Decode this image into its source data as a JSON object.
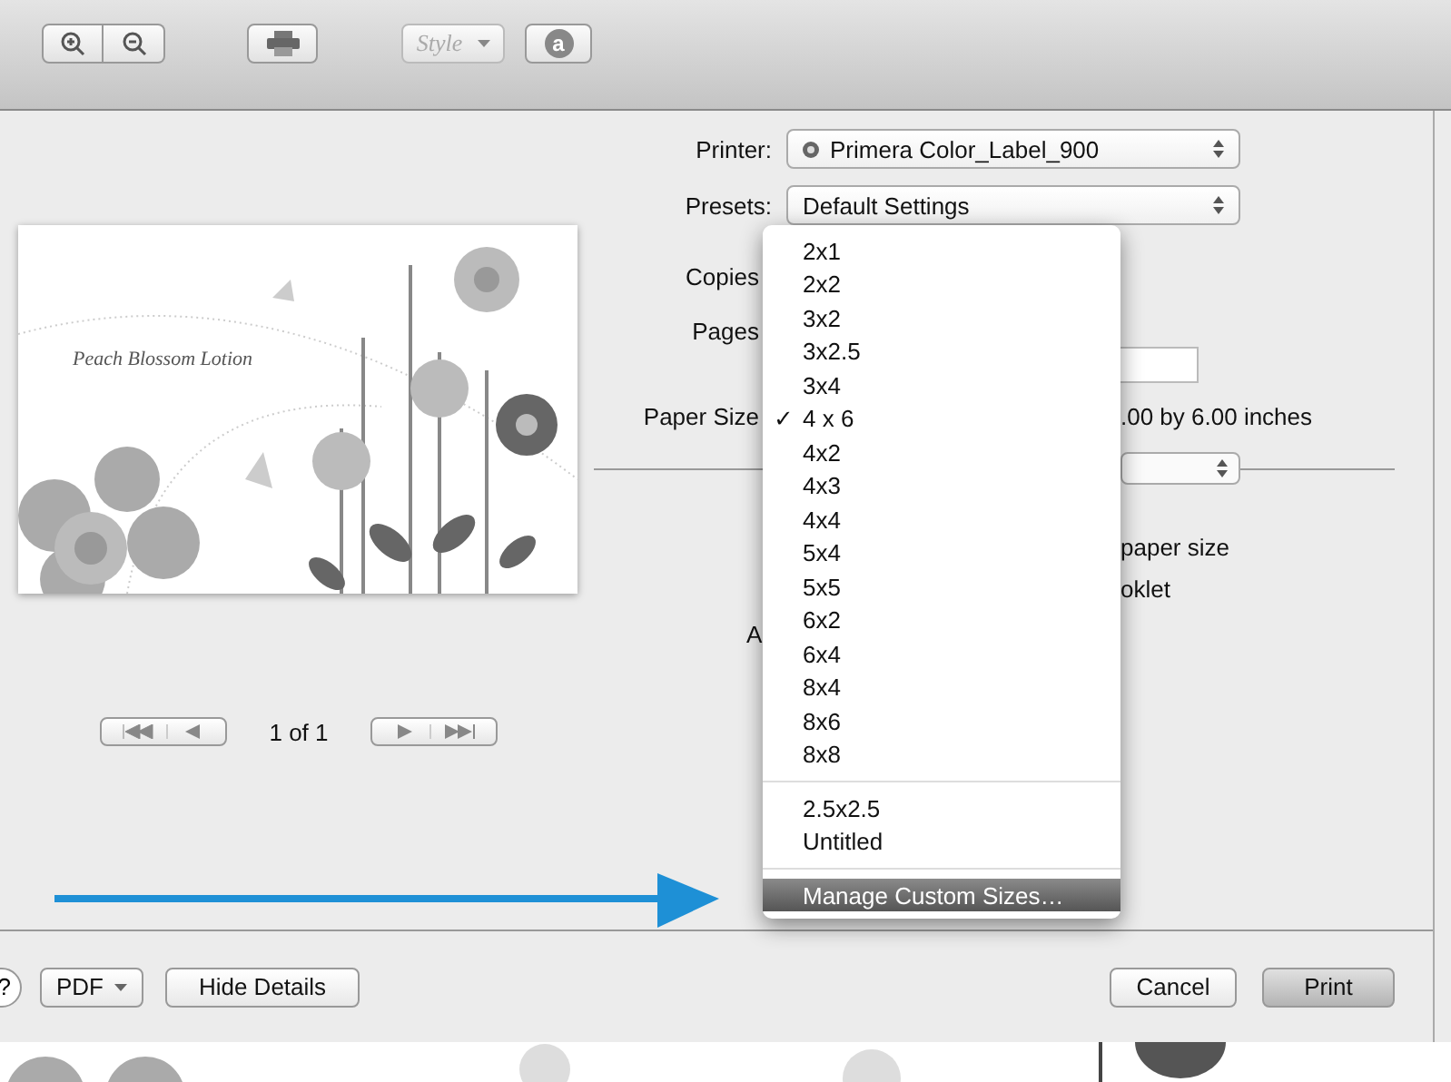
{
  "toolbar": {
    "buttons": [
      {
        "kind": "zoom-in"
      },
      {
        "kind": "zoom-out"
      },
      {
        "kind": "print"
      },
      {
        "kind": "style",
        "label": "Style",
        "disabled": true
      },
      {
        "kind": "text",
        "label": "a"
      }
    ]
  },
  "preview": {
    "document_text": "Peach Blossom Lotion",
    "page_indicator": "1 of 1"
  },
  "form": {
    "printer": {
      "label": "Printer:",
      "value": "Primera Color_Label_900"
    },
    "presets": {
      "label": "Presets:",
      "value": "Default Settings"
    },
    "copies_label": "Copies",
    "pages_label": "Pages",
    "paper_size_label": "Paper Size",
    "paper_size_note": ".00 by 6.00 inches",
    "scale_text": "paper size",
    "booklet_text": "oklet",
    "layout_label": "A"
  },
  "paper_size_menu": {
    "groups": [
      {
        "items": [
          {
            "label": "2x1",
            "selected": false
          },
          {
            "label": "2x2",
            "selected": false
          },
          {
            "label": "3x2",
            "selected": false
          },
          {
            "label": "3x2.5",
            "selected": false
          },
          {
            "label": "3x4",
            "selected": false
          },
          {
            "label": "4 x 6",
            "selected": true
          },
          {
            "label": "4x2",
            "selected": false
          },
          {
            "label": "4x3",
            "selected": false
          },
          {
            "label": "4x4",
            "selected": false
          },
          {
            "label": "5x4",
            "selected": false
          },
          {
            "label": "5x5",
            "selected": false
          },
          {
            "label": "6x2",
            "selected": false
          },
          {
            "label": "6x4",
            "selected": false
          },
          {
            "label": "8x4",
            "selected": false
          },
          {
            "label": "8x6",
            "selected": false
          },
          {
            "label": "8x8",
            "selected": false
          }
        ]
      },
      {
        "items": [
          {
            "label": "2.5x2.5",
            "selected": false
          },
          {
            "label": "Untitled",
            "selected": false
          }
        ]
      }
    ],
    "action": {
      "label": "Manage Custom Sizes…",
      "highlighted": true
    },
    "check_mark": "✓"
  },
  "footer": {
    "help": "?",
    "pdf": "PDF",
    "hide_details": "Hide Details",
    "cancel": "Cancel",
    "print": "Print"
  }
}
